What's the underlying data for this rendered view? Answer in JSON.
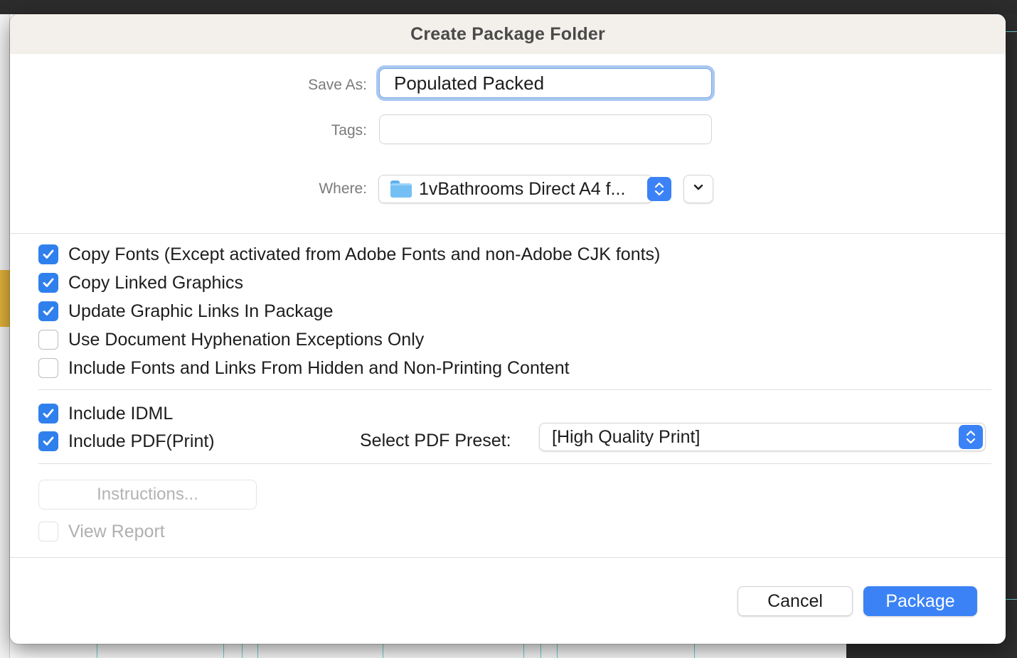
{
  "dialog": {
    "title": "Create Package Folder"
  },
  "save_as": {
    "label": "Save As:",
    "value": "Populated Packed"
  },
  "tags": {
    "label": "Tags:",
    "value": ""
  },
  "where": {
    "label": "Where:",
    "value": "1vBathrooms Direct A4 f..."
  },
  "options": {
    "copy_fonts": {
      "label": "Copy Fonts (Except activated from Adobe Fonts and non-Adobe CJK fonts)",
      "checked": true
    },
    "copy_linked_graphics": {
      "label": "Copy Linked Graphics",
      "checked": true
    },
    "update_graphic_links": {
      "label": "Update Graphic Links In Package",
      "checked": true
    },
    "hyphenation_exceptions": {
      "label": "Use Document Hyphenation Exceptions Only",
      "checked": false
    },
    "hidden_nonprinting": {
      "label": "Include Fonts and Links From Hidden and Non-Printing Content",
      "checked": false
    },
    "include_idml": {
      "label": "Include IDML",
      "checked": true
    },
    "include_pdf": {
      "label": "Include PDF(Print)",
      "checked": true
    }
  },
  "pdf_preset": {
    "label": "Select PDF Preset:",
    "value": "[High Quality Print]"
  },
  "instructions_button": {
    "label": "Instructions..."
  },
  "view_report": {
    "label": "View Report",
    "checked": false,
    "enabled": false
  },
  "buttons": {
    "cancel": "Cancel",
    "package": "Package"
  },
  "colors": {
    "accent": "#3b82f6",
    "checkbox_on": "#2f80ed",
    "titlebar": "#f3efeb"
  }
}
